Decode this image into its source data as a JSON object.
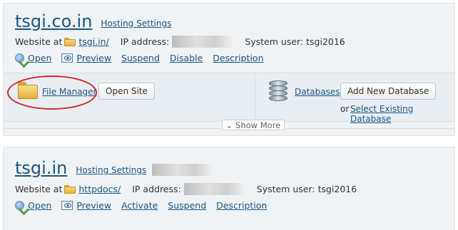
{
  "domains": [
    {
      "name": "tsgi.co.in",
      "hosting_settings": "Hosting Settings",
      "website_at_label": "Website at",
      "website_path": "tsgi.in/",
      "ip_label": "IP address:",
      "system_user": "System user: tsgi2016",
      "actions": [
        "Open",
        "Preview",
        "Suspend",
        "Disable",
        "Description"
      ]
    },
    {
      "name": "tsgi.in",
      "hosting_settings": "Hosting Settings",
      "website_at_label": "Website at",
      "website_path": "httpdocs/",
      "ip_label": "IP address:",
      "system_user": "System user: tsgi2016",
      "actions": [
        "Open",
        "Preview",
        "Activate",
        "Suspend",
        "Description"
      ]
    }
  ],
  "panel": {
    "file_manager": "File Manager",
    "open_site": "Open Site",
    "databases": "Databases",
    "add_new_database": "Add New Database",
    "or_label": "or",
    "select_existing_database": "Select Existing Database",
    "show_more": "Show More"
  },
  "colors": {
    "link": "#1b5585",
    "card_bg": "#f0f3f6",
    "annotation_oval": "#d8262a"
  }
}
